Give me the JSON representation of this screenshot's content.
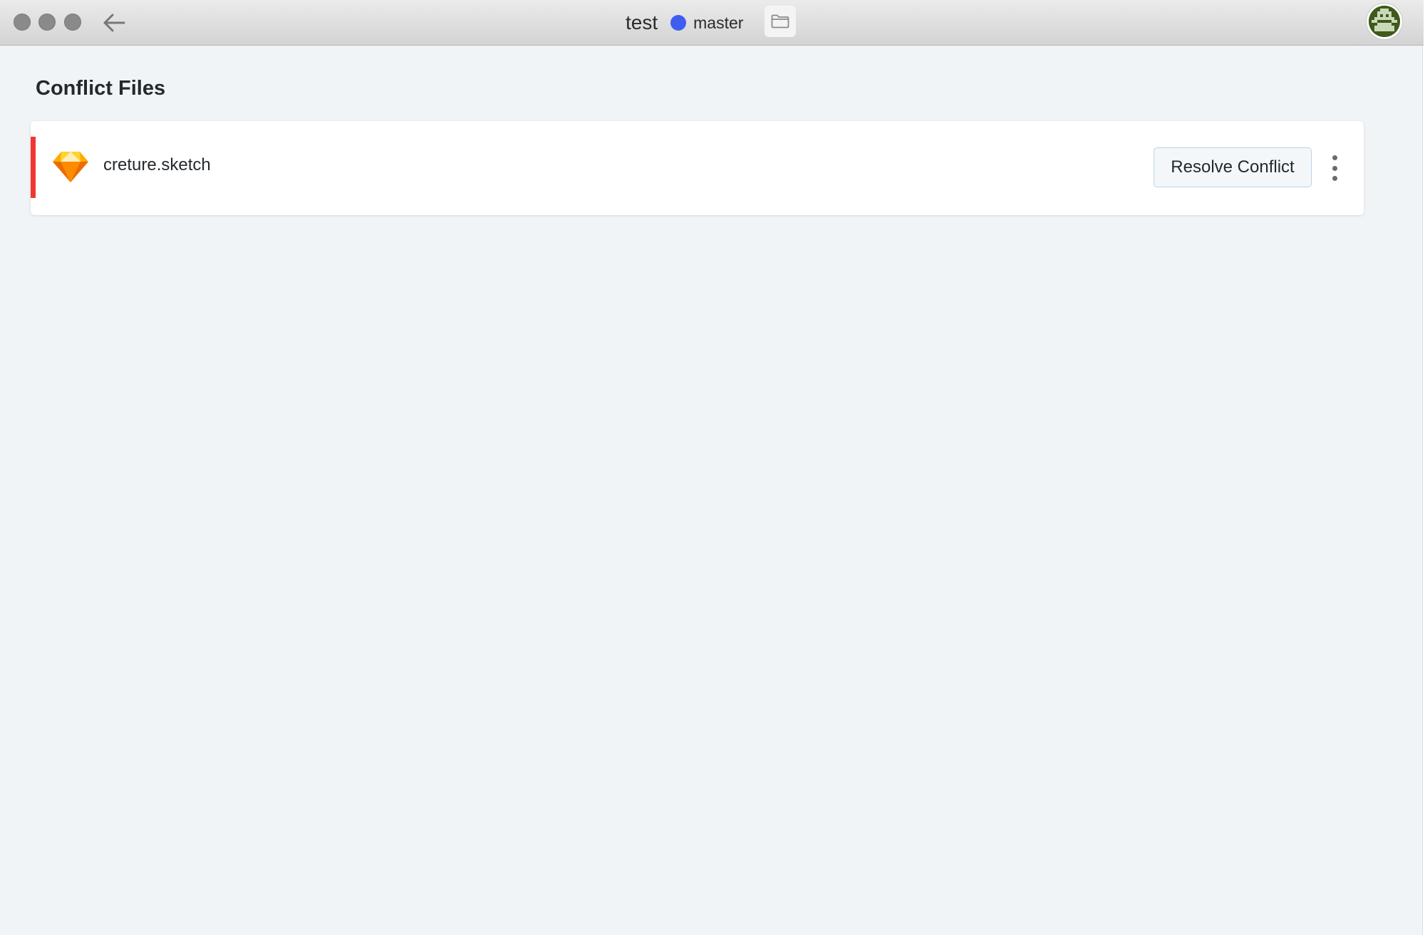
{
  "window": {
    "repo_name": "test",
    "branch": {
      "name": "master",
      "color": "#3f5ef0"
    },
    "icons": {
      "back": "arrow-left-icon",
      "folder": "folder-icon",
      "avatar": "user-avatar"
    }
  },
  "main": {
    "section_title": "Conflict Files",
    "files": [
      {
        "name": "creture.sketch",
        "icon": "sketch-diamond-icon",
        "status_color": "#f0382e",
        "action_label": "Resolve Conflict"
      }
    ]
  }
}
